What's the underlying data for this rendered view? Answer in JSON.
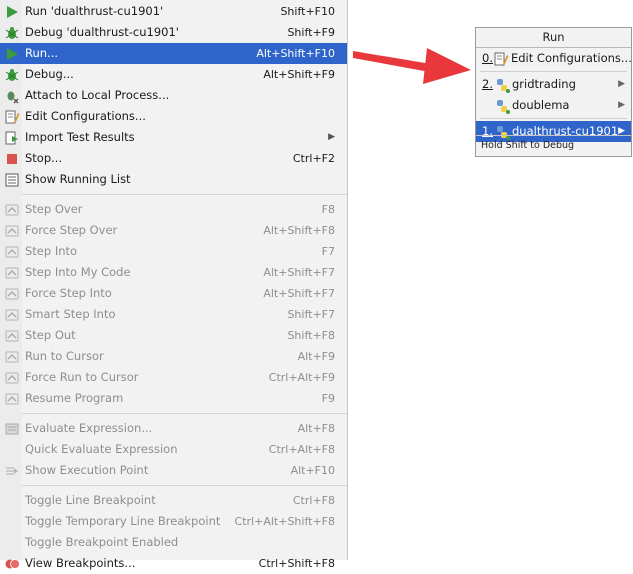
{
  "menu": {
    "group1": [
      {
        "label": "Run 'dualthrust-cu1901'",
        "shortcut": "Shift+F10",
        "icon": "run-play-icon",
        "disabled": false,
        "selected": false
      },
      {
        "label": "Debug 'dualthrust-cu1901'",
        "shortcut": "Shift+F9",
        "icon": "debug-bug-icon",
        "disabled": false,
        "selected": false
      },
      {
        "label": "Run...",
        "shortcut": "Alt+Shift+F10",
        "icon": "run-play-icon",
        "disabled": false,
        "selected": true
      },
      {
        "label": "Debug...",
        "shortcut": "Alt+Shift+F9",
        "icon": "debug-bug-icon",
        "disabled": false,
        "selected": false
      },
      {
        "label": "Attach to Local Process...",
        "shortcut": "",
        "icon": "attach-process-icon",
        "disabled": false,
        "selected": false
      },
      {
        "label": "Edit Configurations...",
        "shortcut": "",
        "icon": "edit-config-icon",
        "disabled": false,
        "selected": false
      },
      {
        "label": "Import Test Results",
        "shortcut": "",
        "icon": "import-tests-icon",
        "disabled": false,
        "selected": false,
        "submenu": true
      },
      {
        "label": "Stop...",
        "shortcut": "Ctrl+F2",
        "icon": "stop-icon",
        "disabled": false,
        "selected": false
      },
      {
        "label": "Show Running List",
        "shortcut": "",
        "icon": "list-icon",
        "disabled": false,
        "selected": false
      }
    ],
    "group2": [
      {
        "label": "Step Over",
        "shortcut": "F8",
        "icon": "step-over-icon"
      },
      {
        "label": "Force Step Over",
        "shortcut": "Alt+Shift+F8",
        "icon": "force-step-over-icon"
      },
      {
        "label": "Step Into",
        "shortcut": "F7",
        "icon": "step-into-icon"
      },
      {
        "label": "Step Into My Code",
        "shortcut": "Alt+Shift+F7",
        "icon": "step-into-my-code-icon"
      },
      {
        "label": "Force Step Into",
        "shortcut": "Alt+Shift+F7",
        "icon": "force-step-into-icon"
      },
      {
        "label": "Smart Step Into",
        "shortcut": "Shift+F7",
        "icon": "smart-step-into-icon"
      },
      {
        "label": "Step Out",
        "shortcut": "Shift+F8",
        "icon": "step-out-icon"
      },
      {
        "label": "Run to Cursor",
        "shortcut": "Alt+F9",
        "icon": "run-to-cursor-icon"
      },
      {
        "label": "Force Run to Cursor",
        "shortcut": "Ctrl+Alt+F9",
        "icon": "force-run-to-cursor-icon"
      },
      {
        "label": "Resume Program",
        "shortcut": "F9",
        "icon": "resume-icon"
      }
    ],
    "group3": [
      {
        "label": "Evaluate Expression...",
        "shortcut": "Alt+F8",
        "icon": "evaluate-icon"
      },
      {
        "label": "Quick Evaluate Expression",
        "shortcut": "Ctrl+Alt+F8",
        "icon": ""
      },
      {
        "label": "Show Execution Point",
        "shortcut": "Alt+F10",
        "icon": "execution-point-icon"
      }
    ],
    "group4": [
      {
        "label": "Toggle Line Breakpoint",
        "shortcut": "Ctrl+F8",
        "icon": "",
        "disabled": true
      },
      {
        "label": "Toggle Temporary Line Breakpoint",
        "shortcut": "Ctrl+Alt+Shift+F8",
        "icon": "",
        "disabled": true
      },
      {
        "label": "Toggle Breakpoint Enabled",
        "shortcut": "",
        "icon": "",
        "disabled": true
      },
      {
        "label": "View Breakpoints...",
        "shortcut": "Ctrl+Shift+F8",
        "icon": "breakpoints-icon",
        "disabled": false
      }
    ]
  },
  "popup": {
    "title": "Run",
    "items": [
      {
        "num": "0.",
        "label": "Edit Configurations...",
        "icon": "edit-config-icon",
        "submenu": false,
        "selected": false
      },
      {
        "num": "2.",
        "label": "gridtrading",
        "icon": "python-icon",
        "submenu": true,
        "selected": false
      },
      {
        "num": "",
        "label": "doublema",
        "icon": "python-icon",
        "submenu": true,
        "selected": false
      },
      {
        "num": "1.",
        "label": "dualthrust-cu1901",
        "icon": "python-icon",
        "submenu": true,
        "selected": true
      }
    ],
    "footer": "Hold Shift to Debug"
  },
  "colors": {
    "selection": "#2f65ca",
    "arrow": "#e8383b",
    "menu_bg": "#f2f2f2"
  }
}
